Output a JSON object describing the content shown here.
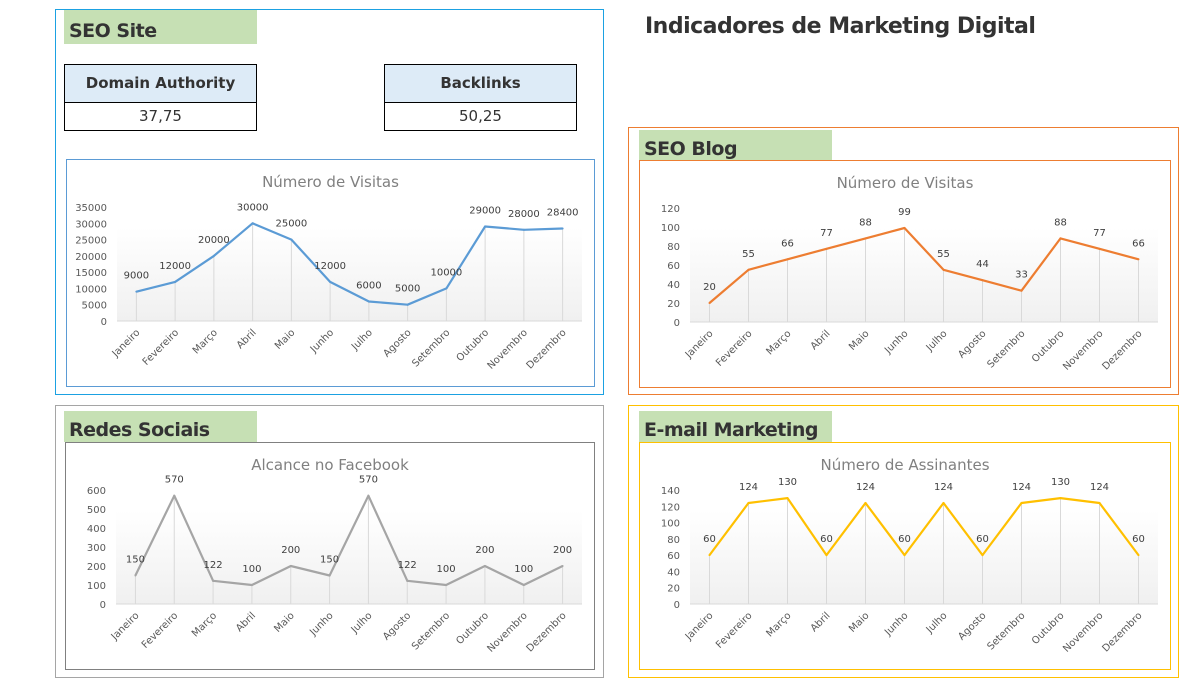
{
  "page": {
    "title": "Indicadores de Marketing Digital"
  },
  "sections": {
    "seo_site": {
      "label": "SEO Site",
      "border_color": "#1BA1E2",
      "kpis": [
        {
          "label": "Domain Authority",
          "value": "37,75"
        },
        {
          "label": "Backlinks",
          "value": "50,25"
        }
      ]
    },
    "seo_blog": {
      "label": "SEO Blog",
      "border_color": "#ED7D31"
    },
    "redes_sociais": {
      "label": "Redes Sociais",
      "border_color": "#A5A5A5"
    },
    "email_marketing": {
      "label": "E-mail Marketing",
      "border_color": "#FFC000"
    }
  },
  "chart_data": [
    {
      "id": "seo-site-visits",
      "type": "line",
      "title": "Número de Visitas",
      "color": "#5B9BD5",
      "categories": [
        "Janeiro",
        "Fevereiro",
        "Março",
        "Abril",
        "Maio",
        "Junho",
        "Julho",
        "Agosto",
        "Setembro",
        "Outubro",
        "Novembro",
        "Dezembro"
      ],
      "values": [
        9000,
        12000,
        20000,
        30000,
        25000,
        12000,
        6000,
        5000,
        10000,
        29000,
        28000,
        28400
      ],
      "ylim": [
        0,
        35000
      ],
      "yticks": [
        0,
        5000,
        10000,
        15000,
        20000,
        25000,
        30000,
        35000
      ],
      "xlabel": "",
      "ylabel": "",
      "data_labels": true
    },
    {
      "id": "seo-blog-visits",
      "type": "line",
      "title": "Número de Visitas",
      "color": "#ED7D31",
      "categories": [
        "Janeiro",
        "Fevereiro",
        "Março",
        "Abril",
        "Maio",
        "Junho",
        "Julho",
        "Agosto",
        "Setembro",
        "Outubro",
        "Novembro",
        "Dezembro"
      ],
      "values": [
        20,
        55,
        66,
        77,
        88,
        99,
        55,
        44,
        33,
        88,
        77,
        66
      ],
      "ylim": [
        0,
        120
      ],
      "yticks": [
        0,
        20,
        40,
        60,
        80,
        100,
        120
      ],
      "xlabel": "",
      "ylabel": "",
      "data_labels": true
    },
    {
      "id": "facebook-reach",
      "type": "line",
      "title": "Alcance no Facebook",
      "color": "#A5A5A5",
      "categories": [
        "Janeiro",
        "Fevereiro",
        "Março",
        "Abril",
        "Maio",
        "Junho",
        "Julho",
        "Agosto",
        "Setembro",
        "Outubro",
        "Novembro",
        "Dezembro"
      ],
      "values": [
        150,
        570,
        122,
        100,
        200,
        150,
        570,
        122,
        100,
        200,
        100,
        200
      ],
      "ylim": [
        0,
        600
      ],
      "yticks": [
        0,
        100,
        200,
        300,
        400,
        500,
        600
      ],
      "xlabel": "",
      "ylabel": "",
      "data_labels": true
    },
    {
      "id": "email-subscribers",
      "type": "line",
      "title": "Número de Assinantes",
      "color": "#FFC000",
      "categories": [
        "Janeiro",
        "Fevereiro",
        "Março",
        "Abril",
        "Maio",
        "Junho",
        "Julho",
        "Agosto",
        "Setembro",
        "Outubro",
        "Novembro",
        "Dezembro"
      ],
      "values": [
        60,
        124,
        130,
        60,
        124,
        60,
        124,
        60,
        124,
        130,
        124,
        60
      ],
      "ylim": [
        0,
        140
      ],
      "yticks": [
        0,
        20,
        40,
        60,
        80,
        100,
        120,
        140
      ],
      "xlabel": "",
      "ylabel": "",
      "data_labels": true
    }
  ]
}
